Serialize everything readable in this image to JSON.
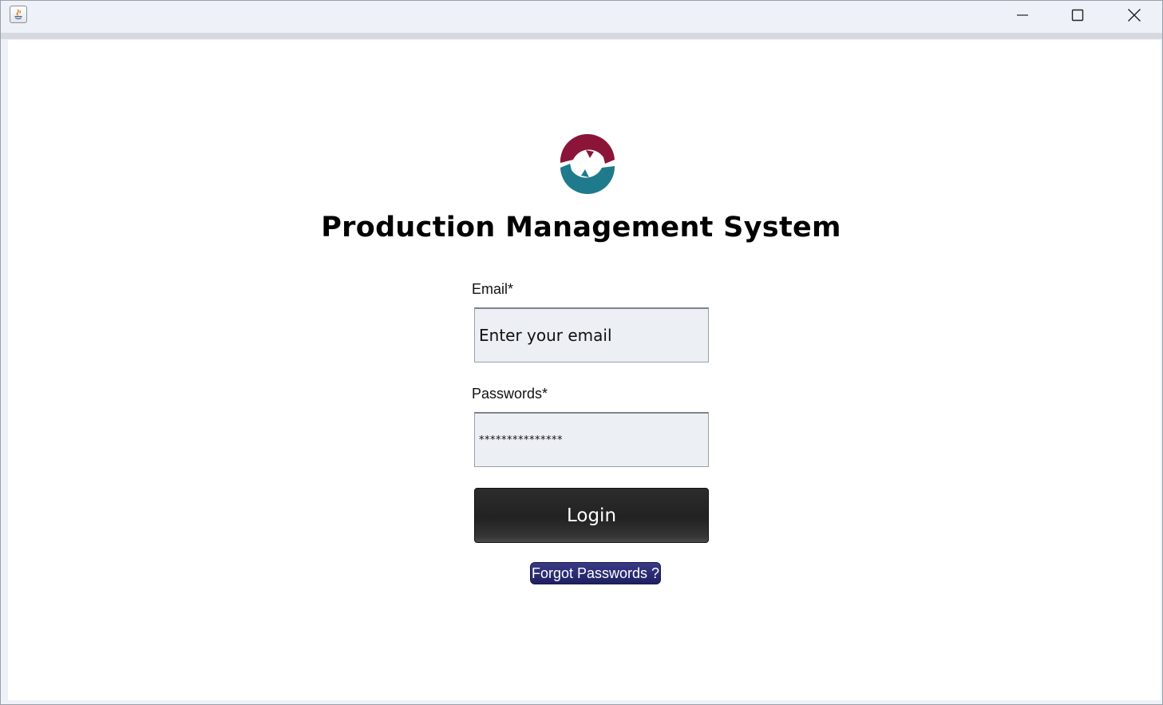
{
  "window": {
    "app_icon": "java-icon",
    "controls": [
      "minimize-icon",
      "maximize-icon",
      "close-icon"
    ]
  },
  "brand": {
    "logo": "production-logo",
    "colors": {
      "logo_top": "#8b1538",
      "logo_bottom": "#1f7a8c"
    }
  },
  "header": {
    "title": "Production Management System"
  },
  "form": {
    "email_label": "Email*",
    "email_placeholder": "Enter your email",
    "password_label": "Passwords*",
    "password_value": "***************",
    "login_label": "Login",
    "forgot_label": "Forgot Passwords ?"
  },
  "colors": {
    "login_button": "#262626",
    "forgot_button": "#27276e",
    "field_background": "#eceff3"
  }
}
